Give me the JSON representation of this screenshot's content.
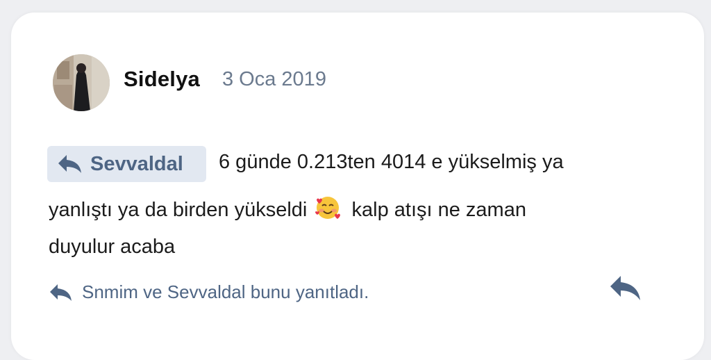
{
  "post": {
    "author": "Sidelya",
    "date": "3 Oca 2019",
    "mention": "Sevvaldal",
    "text_line1": "6 günde 0.213ten 4014 e yükselmiş ya",
    "text_line2_before_emoji": "yanlıştı ya da birden yükseldi",
    "emoji": "smiling-face-with-hearts",
    "text_line2_after_emoji": "kalp atışı ne zaman",
    "text_line3": "duyulur acaba",
    "replies_text": "Snmim ve Sevvaldal bunu yanıtladı."
  },
  "icons": {
    "reply": "reply-arrow-icon",
    "mention": "reply-arrow-icon"
  },
  "colors": {
    "accent": "#4e6584",
    "mention_bg": "#e2e8f1",
    "date": "#6b7a8e",
    "text": "#1b1b1b"
  }
}
